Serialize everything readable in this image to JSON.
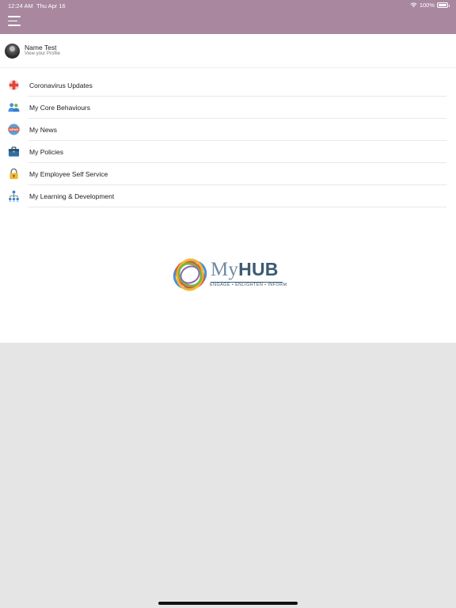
{
  "status_bar": {
    "time": "12:24 AM",
    "date": "Thu Apr 16",
    "battery": "100%",
    "icons": [
      "wifi-icon",
      "battery-icon"
    ]
  },
  "header": {
    "bg_color": "#a8879f",
    "menu_icon": "hamburger-menu-icon"
  },
  "profile": {
    "name": "Name Test",
    "subtitle": "View your Profile"
  },
  "menu": {
    "items": [
      {
        "label": "Coronavirus Updates",
        "icon": "medical-cross-icon"
      },
      {
        "label": "My Core Behaviours",
        "icon": "people-icon"
      },
      {
        "label": "My News",
        "icon": "news-icon"
      },
      {
        "label": "My Policies",
        "icon": "briefcase-icon"
      },
      {
        "label": "My Employee Self Service",
        "icon": "padlock-icon"
      },
      {
        "label": "My Learning & Development",
        "icon": "org-chart-icon"
      }
    ]
  },
  "logo": {
    "name_prefix": "My",
    "name_main": "HUB",
    "tagline": "ENGAGE • ENLIGHTEN • INFORM"
  }
}
